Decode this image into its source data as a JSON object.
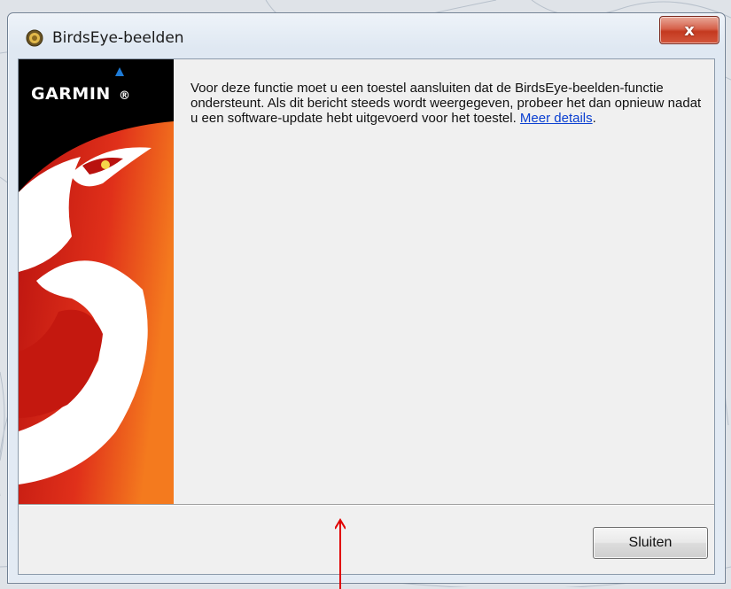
{
  "window": {
    "title": "BirdsEye-beelden",
    "close_glyph": "x"
  },
  "banner": {
    "brand": "GARMIN",
    "registered": "®",
    "colors": {
      "background": "#000000",
      "red": "#d21a12",
      "orange": "#f07a1a"
    }
  },
  "message": {
    "text": "Voor deze functie moet u een toestel aansluiten dat de BirdsEye-beelden-functie ondersteunt. Als dit bericht steeds wordt weergegeven, probeer het dan opnieuw nadat u een software-update hebt uitgevoerd voor het toestel.",
    "link_label": "Meer details",
    "trailing": "."
  },
  "footer": {
    "close_button_label": "Sluiten"
  },
  "annotation": {
    "color": "#e00000"
  }
}
